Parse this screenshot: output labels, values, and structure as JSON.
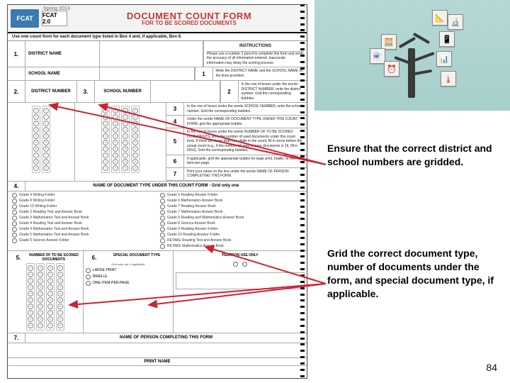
{
  "term": "Spring 2013",
  "logo": "FCAT",
  "logo2": "FCAT 2.0",
  "title": "DOCUMENT COUNT FORM",
  "subtitle": "FOR TO BE SCORED DOCUMENTS",
  "subhead": "Use one count form for each document type listed in Box 4 and, if applicable, Box 6.",
  "instructions_head": "INSTRUCTIONS",
  "instructions_intro": "Please use a number 2 pencil to complete this form and verify the accuracy of all information entered. Inaccurate information may delay the scoring process.",
  "rows": {
    "r1": "DISTRICT NAME",
    "r2": "SCHOOL NAME",
    "r3a": "DISTRICT NUMBER",
    "r3b": "SCHOOL NUMBER"
  },
  "instr": {
    "i1": "Write the DISTRICT NAME and the SCHOOL NAME on the lines provided.",
    "i2": "In the row of boxes under the words DISTRICT NUMBER, write the district number. Grid the corresponding bubbles.",
    "i3": "In the row of boxes under the words SCHOOL NUMBER, write the school number. Grid the corresponding bubbles.",
    "i4": "Under the words NAME OF DOCUMENT TYPE UNDER THIS COUNT FORM, grid the appropriate bubble.",
    "i5": "In the row of boxes under the words NUMBER OF TO BE SCORED DOCUMENTS, write the number of used documents under this count form. If there are fewer than four digits in the count, fill in zeros before the actual count (e.g., if the number of used answer documents is 16, fill in 0016). Grid the corresponding bubbles.",
    "i6": "If applicable, grid the appropriate bubble for large print, braille, or one-item-per-page.",
    "i7": "Print your name on the line under the words NAME OF PERSON COMPLETING THIS FORM."
  },
  "section4": "NAME OF DOCUMENT TYPE UNDER THIS COUNT FORM - Grid only one",
  "docs_left": [
    "Grade 4 Writing Folder",
    "Grade 8 Writing Folder",
    "Grade 10 Writing Folder",
    "Grade 3 Reading Test and Answer Book",
    "Grade 3 Mathematics Test and Answer Book",
    "Grade 4 Reading Test and Answer Book",
    "Grade 4 Mathematics Test and Answer Book",
    "Grade 5 Mathematics Test and Answer Book",
    "Grade 5 Science Answer Folder"
  ],
  "docs_right": [
    "Grade 5 Reading Answer Folder",
    "Grade 6 Mathematics Answer Book",
    "Grade 7 Reading Answer Book",
    "Grade 7 Mathematics Answer Book",
    "Grade 8 Reading and Mathematics Answer Book",
    "Grade 8 Science Answer Book",
    "Grade 9 Reading Answer Folder",
    "Grade 10 Reading Answer Folder",
    "RETAKE Reading Test and Answer Book",
    "RETAKE Mathematics Answer Book"
  ],
  "box5": {
    "head": "NUMBER OF TO BE SCORED DOCUMENTS"
  },
  "box6": {
    "head": "SPECIAL DOCUMENT TYPE",
    "sub": "Grid only one, if applicable",
    "opts": [
      "LARGE PRINT",
      "BRAILLE",
      "ONE-ITEM-PER-PAGE"
    ]
  },
  "box_p": "PEARSON USE ONLY",
  "section7": "NAME OF PERSON COMPLETING THIS FORM",
  "print": "PRINT NAME",
  "tree_icons": [
    "📐",
    "🔬",
    "📱",
    "🧮",
    "⚗️",
    "⏰",
    "📊",
    "🌡️"
  ],
  "callout1": "Ensure that the correct district and school numbers are gridded.",
  "callout2": "Grid the correct document type, number of documents under the form, and special document type, if applicable.",
  "page": "84"
}
